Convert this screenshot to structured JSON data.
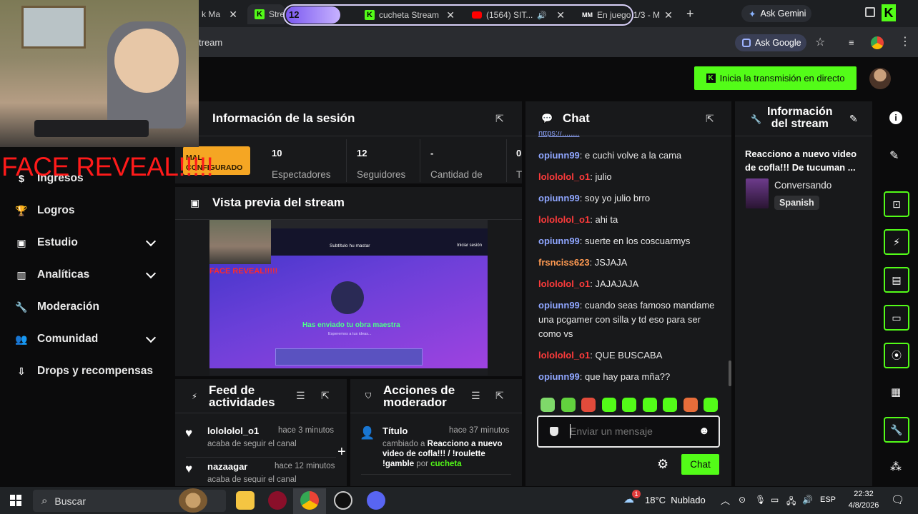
{
  "browser": {
    "tabs": [
      {
        "label": "k Ma"
      },
      {
        "label": "Strea"
      },
      {
        "label": "cucheta Stream"
      },
      {
        "label": "(1564) SIT..."
      },
      {
        "label": "En juego 1/3 - M"
      }
    ],
    "group_count": "12",
    "ask_gemini": "Ask Gemini",
    "url": "tream",
    "ask_google": "Ask Google"
  },
  "header": {
    "go_live": "Inicia la transmisión en directo"
  },
  "overlay": {
    "face_reveal": "FACE REVEAL!!!!!",
    "mal_configurado": "MAL CONFIGURADO"
  },
  "sidebar": {
    "items": [
      {
        "label": "Ingresos"
      },
      {
        "label": "Logros"
      },
      {
        "label": "Estudio"
      },
      {
        "label": "Analíticas"
      },
      {
        "label": "Moderación"
      },
      {
        "label": "Comunidad"
      },
      {
        "label": "Drops y recompensas"
      }
    ]
  },
  "session": {
    "title": "Información de la sesión",
    "stats": [
      {
        "value": "10",
        "label": "Espectadores"
      },
      {
        "value": "12",
        "label": "Seguidores"
      },
      {
        "value": "-",
        "label": "Cantidad de"
      },
      {
        "value": "0",
        "label": "T"
      }
    ]
  },
  "preview": {
    "title": "Vista previa del stream",
    "inner_header": "Subtítulo hu mastar",
    "inner_main": "Has enviado tu obra maestra",
    "inner_sub": "Esperemos a tus ideas...",
    "inner_face": "FACE REVEAL!!!!!",
    "inner_button": "Iniciar sesión"
  },
  "feed": {
    "title_line1": "Feed de",
    "title_line2": "actividades",
    "items": [
      {
        "name": "lolololol_o1",
        "time": "hace 3 minutos",
        "sub": "acaba de seguir el canal"
      },
      {
        "name": "nazaagar",
        "time": "hace 12 minutos",
        "sub": "acaba de seguir el canal"
      }
    ]
  },
  "mod": {
    "title_line1": "Acciones de",
    "title_line2": "moderador",
    "item": {
      "name": "Título",
      "time": "hace 37 minutos",
      "pre": "cambiado a",
      "bold": "Reacciono a nuevo video de cofla!!! / !roulette !gamble",
      "by": "por",
      "user": "cucheta"
    }
  },
  "chat": {
    "title": "Chat",
    "messages": [
      {
        "user": "opiunn99",
        "text": "e cuchi volve a la cama",
        "color": "#8fa6ff"
      },
      {
        "user": "lolololol_o1",
        "text": "julio",
        "color": "#ff3b3b"
      },
      {
        "user": "opiunn99",
        "text": "soy yo julio brro",
        "color": "#8fa6ff"
      },
      {
        "user": "lolololol_o1",
        "text": "ahi ta",
        "color": "#ff3b3b"
      },
      {
        "user": "opiunn99",
        "text": "suerte en los coscuarmys",
        "color": "#8fa6ff"
      },
      {
        "user": "frsnciss623",
        "text": "JSJAJA",
        "color": "#ff9a52"
      },
      {
        "user": "lolololol_o1",
        "text": "JAJAJAJA",
        "color": "#ff3b3b"
      },
      {
        "user": "opiunn99",
        "text": "cuando seas famoso mandame una pcgamer con silla y td eso para ser como vs",
        "color": "#8fa6ff"
      },
      {
        "user": "lolololol_o1",
        "text": "QUE BUSCABA",
        "color": "#ff3b3b"
      },
      {
        "user": "opiunn99",
        "text": "que hay para mña??",
        "color": "#8fa6ff"
      }
    ],
    "input_placeholder": "Enviar un mensaje",
    "send": "Chat"
  },
  "stream_info": {
    "title_line1": "Información",
    "title_line2": "del stream",
    "stream_title": "Reacciono a nuevo video de cofla!!! De tucuman ...",
    "category": "Conversando",
    "language": "Spanish"
  },
  "taskbar": {
    "search": "Buscar",
    "weather": "18°C  Nublado",
    "lang": "ESP",
    "time": "22:32",
    "date": "4/8/2026",
    "notif_count": "1"
  },
  "colors": {
    "accent": "#53fc18",
    "panel": "#18191b",
    "bg": "#0b0b0c"
  }
}
